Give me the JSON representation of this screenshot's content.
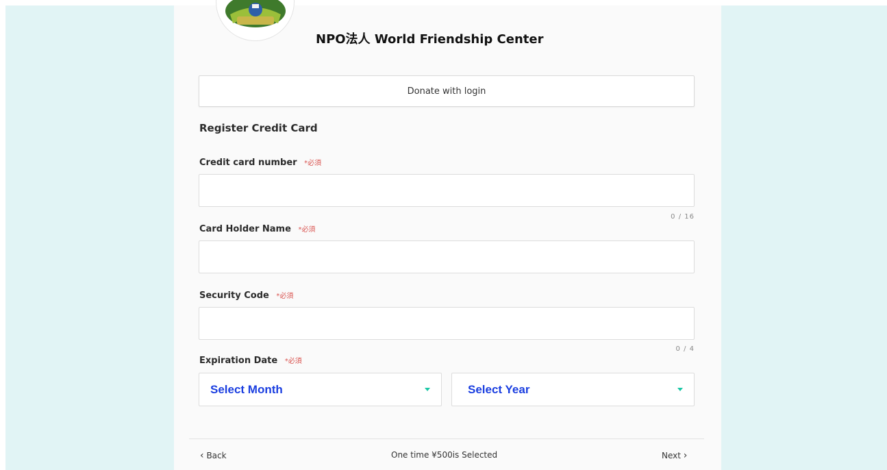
{
  "colors": {
    "page_background": "#e1f4f5",
    "panel_background": "#fafafa",
    "select_text": "#1a3ee0",
    "caret": "#1bc7a6",
    "required_mark": "#d9534f"
  },
  "header": {
    "org_name": "NPO法人 World Friendship Center",
    "logo_icon": "organization-logo-icon"
  },
  "login_button": {
    "label": "Donate with login"
  },
  "form": {
    "section_title": "Register Credit Card",
    "required_mark": "*必須",
    "card_number": {
      "label": "Credit card number",
      "value": "",
      "counter": "0 / 16"
    },
    "holder_name": {
      "label": "Card Holder Name",
      "value": ""
    },
    "security_code": {
      "label": "Security Code",
      "value": "",
      "counter": "0 / 4"
    },
    "expiration": {
      "label": "Expiration Date",
      "month": {
        "selected": "Select Month",
        "icon": "caret-down-icon"
      },
      "year": {
        "selected": "Select Year",
        "icon": "caret-down-icon"
      }
    }
  },
  "footer": {
    "back_label": "Back",
    "back_icon": "chevron-left-icon",
    "status": "One time ¥500is Selected",
    "next_label": "Next",
    "next_icon": "chevron-right-icon"
  }
}
